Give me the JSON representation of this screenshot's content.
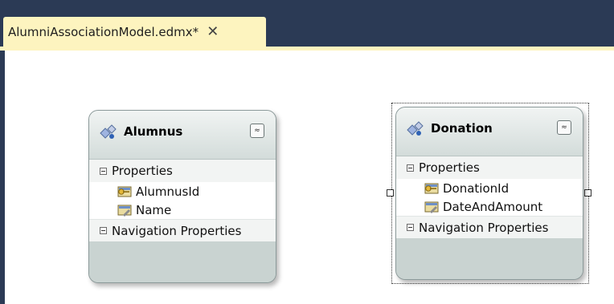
{
  "tab": {
    "title": "AlumniAssociationModel.edmx*",
    "close_glyph": "✕"
  },
  "colors": {
    "frame": "#2b3a55",
    "tab_background": "#fdf4bf",
    "entity_body": "#cfd9d7",
    "section_background": "#f2f4f3"
  },
  "entities": [
    {
      "name": "Alumnus",
      "icon": "entity-icon",
      "collapse_glyph": "≈",
      "properties_label": "Properties",
      "properties": [
        {
          "name": "AlumnusId",
          "icon": "key-property-icon"
        },
        {
          "name": "Name",
          "icon": "property-icon"
        }
      ],
      "navigation_label": "Navigation Properties",
      "selected": false
    },
    {
      "name": "Donation",
      "icon": "entity-icon",
      "collapse_glyph": "≈",
      "properties_label": "Properties",
      "properties": [
        {
          "name": "DonationId",
          "icon": "key-property-icon"
        },
        {
          "name": "DateAndAmount",
          "icon": "property-icon"
        }
      ],
      "navigation_label": "Navigation Properties",
      "selected": true
    }
  ]
}
